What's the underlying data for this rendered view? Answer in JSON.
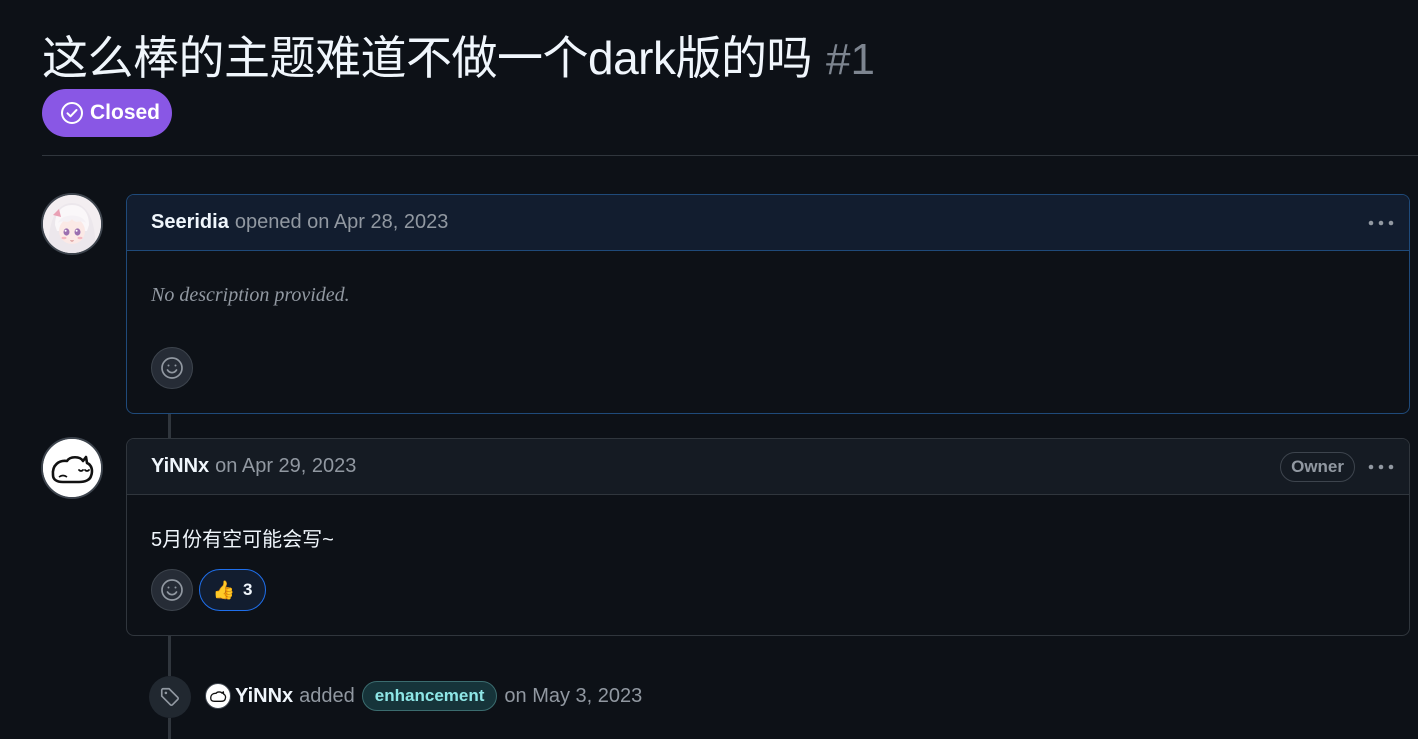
{
  "issue": {
    "title": "这么棒的主题难道不做一个dark版的吗",
    "number": "#1",
    "state": "Closed",
    "state_color": "#8957e5"
  },
  "comments": [
    {
      "author": "Seeridia",
      "meta": "opened on Apr 28, 2023",
      "body": "No description provided.",
      "avatar_icon": "anime-girl-avatar-icon"
    },
    {
      "author": "YiNNx",
      "meta": "on Apr 29, 2023",
      "badge": "Owner",
      "body": "5月份有空可能会写~",
      "avatar_icon": "cat-avatar-icon",
      "reactions": [
        {
          "emoji": "👍",
          "count": "3"
        }
      ]
    }
  ],
  "event": {
    "actor": "YiNNx",
    "action": "added",
    "label": "enhancement",
    "label_color": "#8ee6e6",
    "date": "on May 3, 2023",
    "icon": "tag-icon"
  },
  "colors": {
    "background": "#0d1117",
    "border": "#30363d",
    "accent_blue": "#1f6feb",
    "muted_text": "#9198a1"
  }
}
